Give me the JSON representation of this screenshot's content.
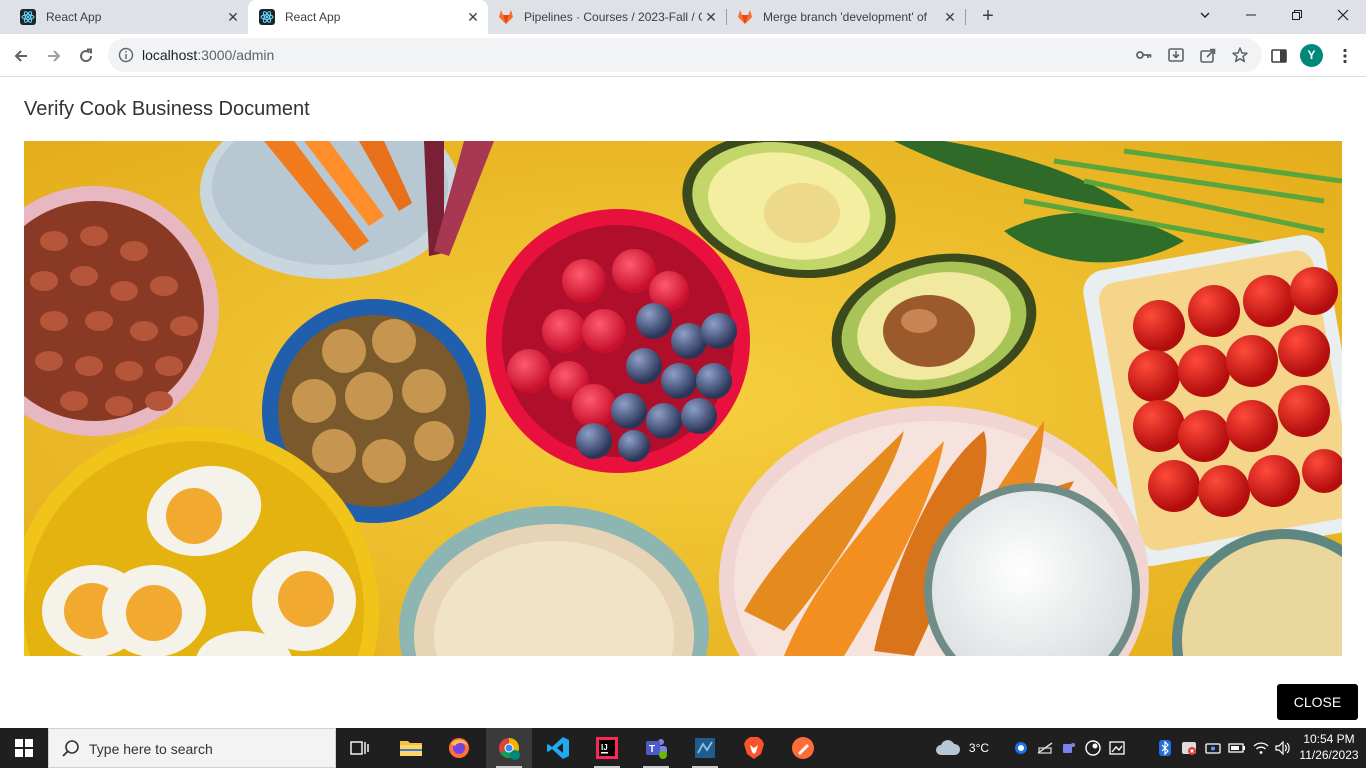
{
  "browser": {
    "tabs": [
      {
        "title": "React App",
        "active": false
      },
      {
        "title": "React App",
        "active": true
      },
      {
        "title": "Pipelines · Courses / 2023-Fall / C",
        "active": false
      },
      {
        "title": "Merge branch 'development' of",
        "active": false
      }
    ],
    "url": {
      "host": "localhost",
      "path": ":3000/admin"
    },
    "avatar_initial": "Y",
    "colors": {
      "tabstrip": "#dee1e6",
      "avatar": "#00897b"
    }
  },
  "page": {
    "title": "Verify Cook Business Document",
    "close_label": "CLOSE"
  },
  "taskbar": {
    "search_placeholder": "Type here to search",
    "weather": "3°C",
    "time": "10:54 PM",
    "date": "11/26/2023"
  }
}
